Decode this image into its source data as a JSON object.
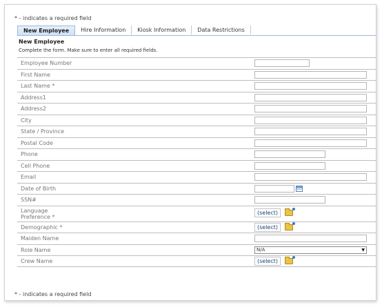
{
  "required_note": "* - indicates a required field",
  "tabs": [
    {
      "label": "New Employee",
      "active": true
    },
    {
      "label": "Hire Information",
      "active": false
    },
    {
      "label": "Kiosk Information",
      "active": false
    },
    {
      "label": "Data Restrictions",
      "active": false
    }
  ],
  "section": {
    "title": "New Employee",
    "description": "Complete the form. Make sure to enter all required fields."
  },
  "fields": {
    "employee_number": {
      "label": "Employee Number",
      "value": ""
    },
    "first_name": {
      "label": "First Name",
      "value": ""
    },
    "last_name": {
      "label": "Last Name *",
      "value": ""
    },
    "address1": {
      "label": "Address1",
      "value": ""
    },
    "address2": {
      "label": "Address2",
      "value": ""
    },
    "city": {
      "label": "City",
      "value": ""
    },
    "state": {
      "label": "State / Province",
      "value": ""
    },
    "postal_code": {
      "label": "Postal Code",
      "value": ""
    },
    "phone": {
      "label": "Phone",
      "value": ""
    },
    "cell_phone": {
      "label": "Cell Phone",
      "value": ""
    },
    "email": {
      "label": "Email",
      "value": ""
    },
    "date_of_birth": {
      "label": "Date of Birth",
      "value": ""
    },
    "ssn": {
      "label": "SSN#",
      "value": ""
    },
    "language_preference": {
      "label_line1": "Language",
      "label_line2": "Preference *",
      "link": "(select)"
    },
    "demographic": {
      "label": "Demographic *",
      "link": "(select)"
    },
    "maiden_name": {
      "label": "Maiden Name",
      "value": ""
    },
    "role_name": {
      "label": "Role Name",
      "selected": "N/A"
    },
    "crew_name": {
      "label": "Crew Name",
      "link": "(select)"
    }
  },
  "icons": {
    "calendar": "calendar-icon",
    "folder": "folder-icon",
    "dropdown": "▼"
  }
}
